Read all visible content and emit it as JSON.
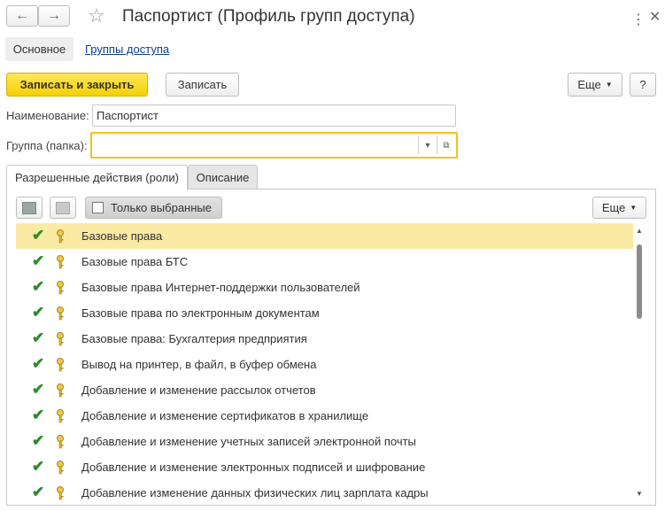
{
  "window": {
    "title": "Паспортист (Профиль групп доступа)"
  },
  "nav": {
    "back_icon": "arrow-left-icon",
    "forward_icon": "arrow-right-icon",
    "favorite_icon": "star-icon",
    "menu_icon": "more-vert-icon",
    "close_icon": "close-icon"
  },
  "tabs_top": {
    "main_label": "Основное",
    "groups_link": "Группы доступа"
  },
  "toolbar": {
    "save_close_label": "Записать и закрыть",
    "save_label": "Записать",
    "more_label": "Еще",
    "help_label": "?"
  },
  "form": {
    "name_label": "Наименование:",
    "name_value": "Паспортист",
    "group_label": "Группа (папка):",
    "group_value": ""
  },
  "tabs": [
    {
      "label": "Разрешенные действия (роли)",
      "active": true
    },
    {
      "label": "Описание",
      "active": false
    }
  ],
  "roles_toolbar": {
    "only_selected_label": "Только выбранные",
    "more_label": "Еще"
  },
  "roles": [
    {
      "label": "Базовые права",
      "checked": true,
      "selected": true
    },
    {
      "label": "Базовые права БТС",
      "checked": true,
      "selected": false
    },
    {
      "label": "Базовые права Интернет-поддержки пользователей",
      "checked": true,
      "selected": false
    },
    {
      "label": "Базовые права по электронным документам",
      "checked": true,
      "selected": false
    },
    {
      "label": "Базовые права: Бухгалтерия предприятия",
      "checked": true,
      "selected": false
    },
    {
      "label": "Вывод на принтер, в файл, в буфер обмена",
      "checked": true,
      "selected": false
    },
    {
      "label": "Добавление и изменение рассылок отчетов",
      "checked": true,
      "selected": false
    },
    {
      "label": "Добавление и изменение сертификатов в хранилище",
      "checked": true,
      "selected": false
    },
    {
      "label": "Добавление и изменение учетных записей электронной почты",
      "checked": true,
      "selected": false
    },
    {
      "label": "Добавление и изменение электронных подписей и шифрование",
      "checked": true,
      "selected": false
    },
    {
      "label": "Добавление изменение данных физических лиц зарплата кадры",
      "checked": true,
      "selected": false
    }
  ],
  "colors": {
    "primary_button": "#f5d100",
    "selected_row": "#fbeaa3",
    "check": "#2e8b2e",
    "link": "#0a3f8f"
  }
}
